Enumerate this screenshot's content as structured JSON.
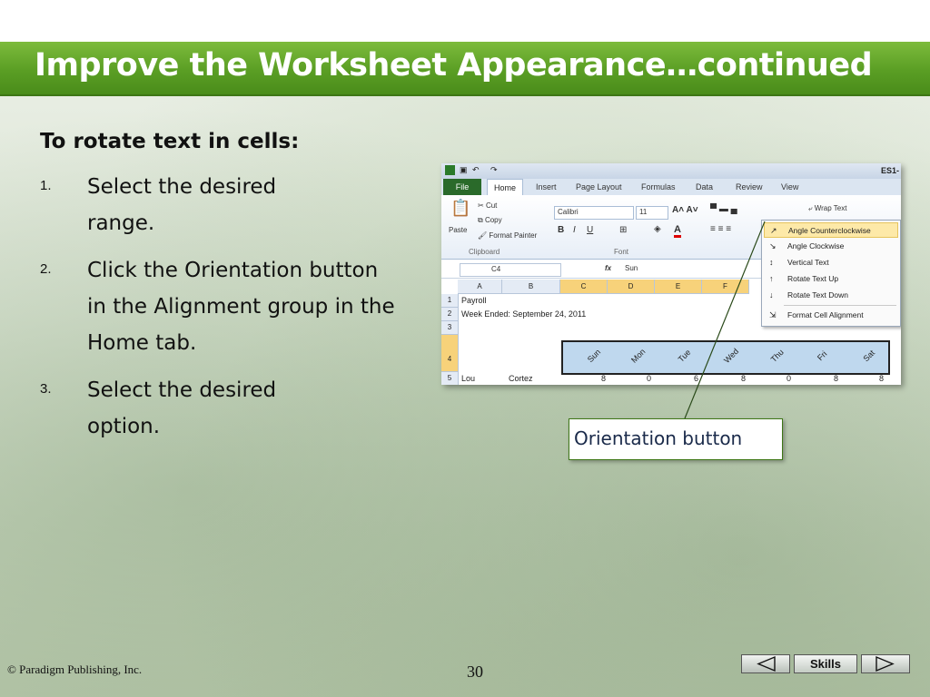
{
  "slide": {
    "title": "Improve the Worksheet Appearance…continued",
    "subheading": "To rotate text in cells:",
    "steps": [
      {
        "num": "1.",
        "text": "Select the desired range."
      },
      {
        "num": "2.",
        "text": "Click the Orientation button in the Alignment group in the Home tab."
      },
      {
        "num": "3.",
        "text": "Select the desired option."
      }
    ],
    "callout": "Orientation button",
    "footer": {
      "copyright": "© Paradigm Publishing, Inc.",
      "page": "30",
      "skills": "Skills"
    }
  },
  "excel": {
    "title_right": "ES1-",
    "tabs": [
      "File",
      "Home",
      "Insert",
      "Page Layout",
      "Formulas",
      "Data",
      "Review",
      "View"
    ],
    "clipboard": {
      "paste": "Paste",
      "cut": "Cut",
      "copy": "Copy",
      "format_painter": "Format Painter",
      "group": "Clipboard"
    },
    "font": {
      "name": "Calibri",
      "size": "11",
      "group": "Font"
    },
    "wrap_text": "Wrap Text",
    "name_box": "C4",
    "formula": "Sun",
    "columns": [
      "A",
      "B",
      "C",
      "D",
      "E",
      "F"
    ],
    "rows": [
      "1",
      "2",
      "3",
      "4",
      "5"
    ],
    "cells": {
      "a1": "Payroll",
      "a2": "Week Ended: September 24, 2011",
      "a5": "Lou",
      "b5": "Cortez"
    },
    "days": [
      "Sun",
      "Mon",
      "Tue",
      "Wed",
      "Thu",
      "Fri",
      "Sat"
    ],
    "row5_values": [
      "8",
      "0",
      "6",
      "8",
      "0",
      "8",
      "8"
    ],
    "menu": [
      "Angle Counterclockwise",
      "Angle Clockwise",
      "Vertical Text",
      "Rotate Text Up",
      "Rotate Text Down",
      "Format Cell Alignment"
    ]
  }
}
